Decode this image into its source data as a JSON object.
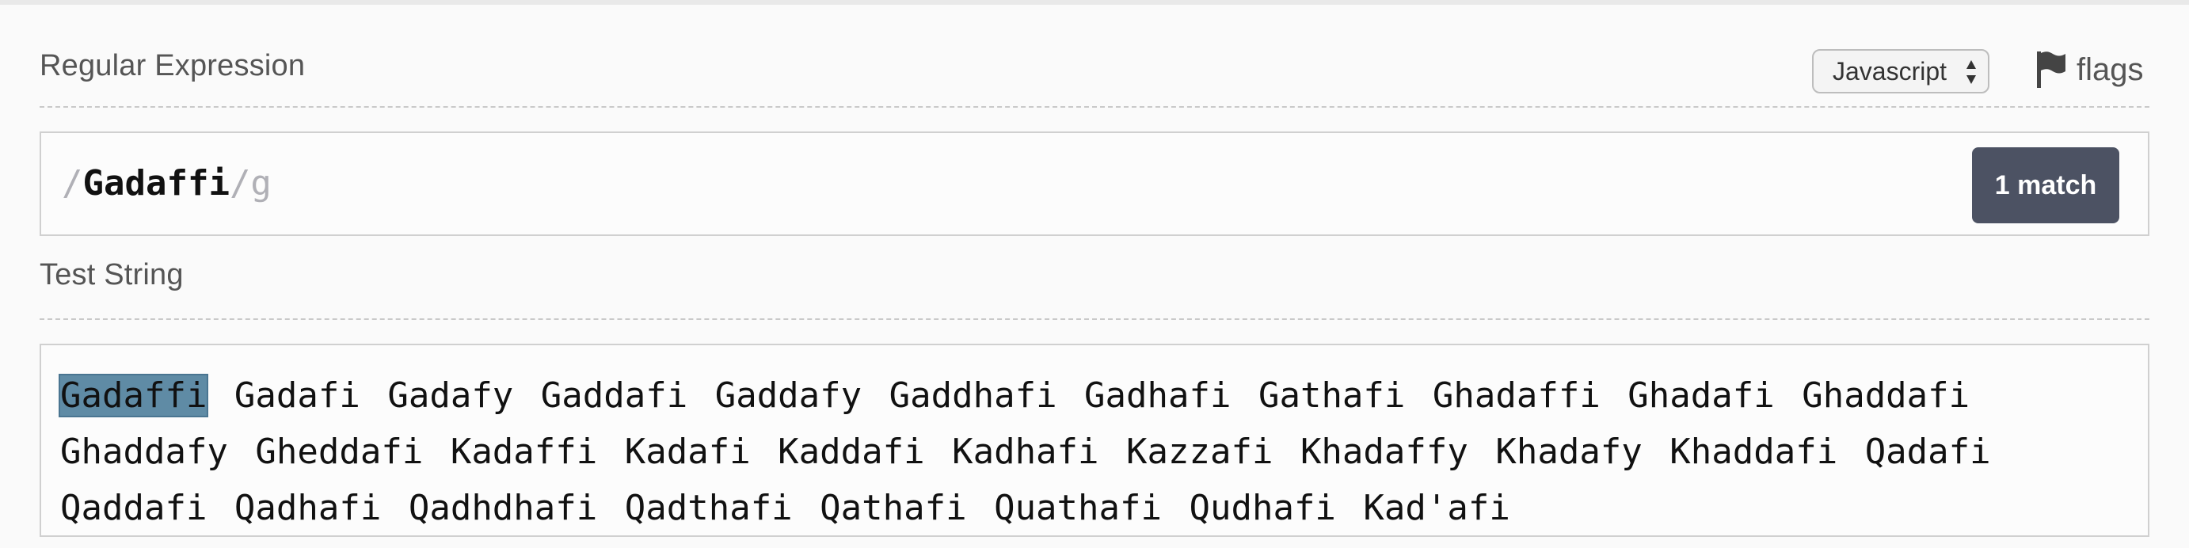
{
  "regex_section": {
    "title": "Regular Expression",
    "language_select": "Javascript",
    "flags_label": "flags",
    "open_delim": "/",
    "pattern": "Gadaffi",
    "close_delim_flags": "/g",
    "match_count": "1 match"
  },
  "test_section": {
    "title": "Test String",
    "highlighted_match": "Gadaffi",
    "rest_of_text": " Gadafi Gadafy Gaddafi Gaddafy Gaddhafi Gadhafi Gathafi Ghadaffi Ghadafi Ghaddafi\nGhaddafy Gheddafi Kadaffi Kadafi Kaddafi Kadhafi Kazzafi Khadaffy Khadafy Khaddafi Qadafi\nQaddafi Qadhafi Qadhdhafi Qadthafi Qathafi Quathafi Qudhafi Kad'afi"
  },
  "colors": {
    "match_badge": "#4c5263",
    "match_highlight": "#5f8ba5"
  },
  "icons": {
    "flags": "flag-icon",
    "select": "up-down-arrows-icon"
  }
}
